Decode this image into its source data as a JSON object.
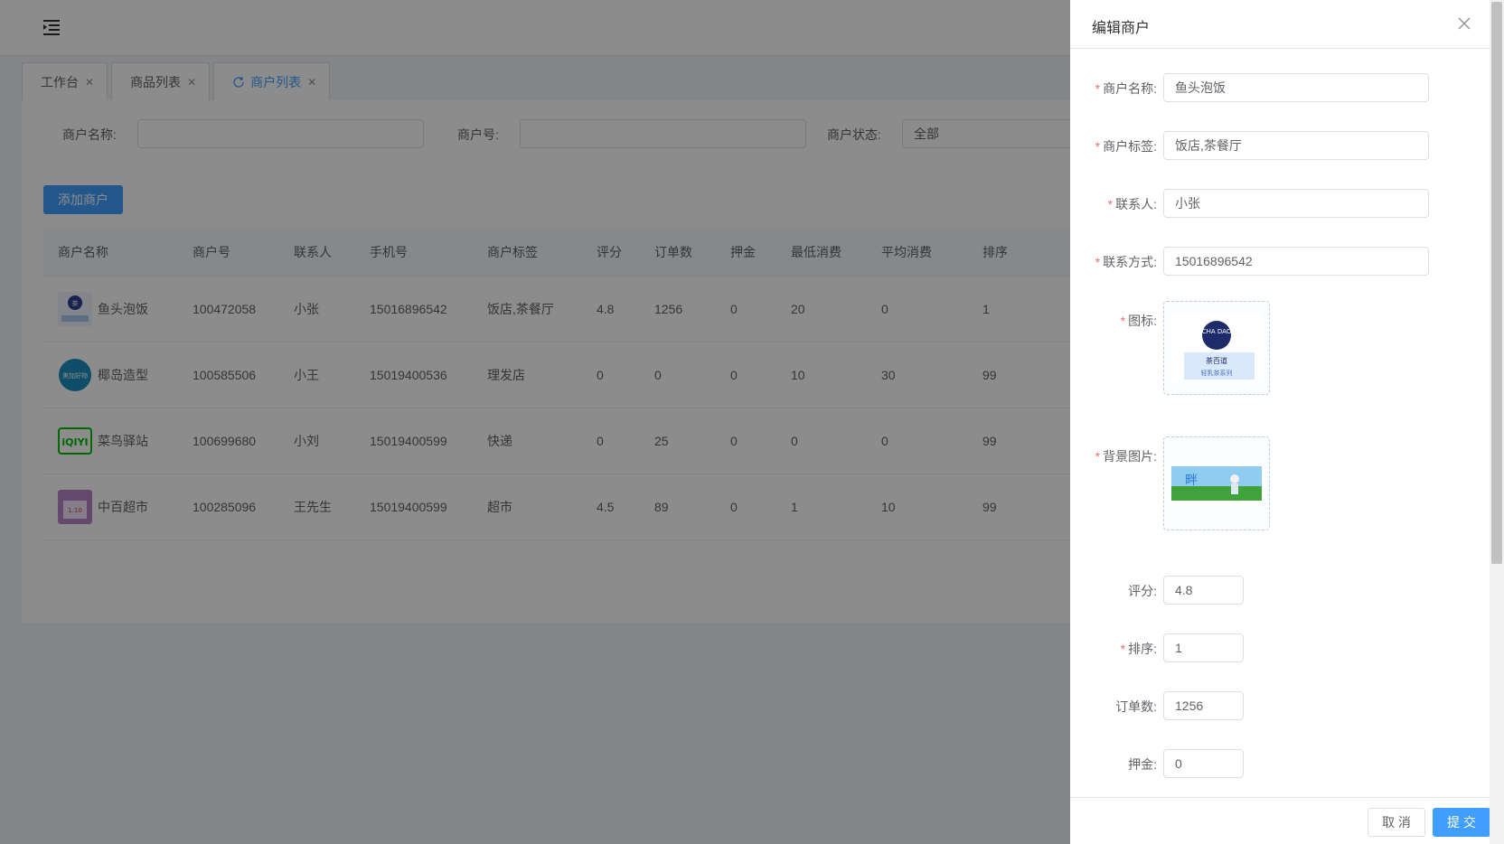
{
  "header": {
    "menu_icon": "indent-menu-icon"
  },
  "tabs": [
    {
      "label": "工作台",
      "active": false
    },
    {
      "label": "商品列表",
      "active": false
    },
    {
      "label": "商户列表",
      "active": true
    }
  ],
  "search": {
    "merchant_name_label": "商户名称:",
    "merchant_name_value": "",
    "merchant_no_label": "商户号:",
    "merchant_no_value": "",
    "status_label": "商户状态:",
    "status_value": "全部"
  },
  "toolbar": {
    "add_label": "添加商户"
  },
  "table": {
    "columns": [
      "商户名称",
      "商户号",
      "联系人",
      "手机号",
      "商户标签",
      "评分",
      "订单数",
      "押金",
      "最低消费",
      "平均消费",
      "排序"
    ],
    "rows": [
      [
        "鱼头泡饭",
        "100472058",
        "小张",
        "15016896542",
        "饭店,茶餐厅",
        "4.8",
        "1256",
        "0",
        "20",
        "0",
        "1"
      ],
      [
        "椰岛造型",
        "100585506",
        "小王",
        "15019400536",
        "理发店",
        "0",
        "0",
        "0",
        "10",
        "30",
        "99"
      ],
      [
        "菜鸟驿站",
        "100699680",
        "小刘",
        "15019400599",
        "快递",
        "0",
        "25",
        "0",
        "0",
        "0",
        "99"
      ],
      [
        "中百超市",
        "100285096",
        "王先生",
        "15019400599",
        "超市",
        "4.5",
        "89",
        "0",
        "1",
        "10",
        "99"
      ]
    ],
    "logos": [
      {
        "text": "茶",
        "color": "#2a3f8f"
      },
      {
        "text": "美加好物",
        "color": "#1a8fbf"
      },
      {
        "text": "iQIYI",
        "color": "#00be06"
      },
      {
        "text": "1.10",
        "color": "#b784c9"
      }
    ]
  },
  "drawer": {
    "title": "编辑商户",
    "fields": {
      "name": {
        "label": "商户名称:",
        "value": "鱼头泡饭",
        "required": true
      },
      "tags": {
        "label": "商户标签:",
        "value": "饭店,茶餐厅",
        "required": true
      },
      "contact": {
        "label": "联系人:",
        "value": "小张",
        "required": true
      },
      "phone": {
        "label": "联系方式:",
        "value": "15016896542",
        "required": true
      },
      "icon": {
        "label": "图标:",
        "required": true,
        "caption_top": "CHA DAO",
        "caption_bottom": "茶百道",
        "caption_sub": "轻乳茶系列"
      },
      "background": {
        "label": "背景图片:",
        "required": true,
        "caption": "畔"
      },
      "rating": {
        "label": "评分:",
        "value": "4.8",
        "required": false
      },
      "sort": {
        "label": "排序:",
        "value": "1",
        "required": true
      },
      "orders": {
        "label": "订单数:",
        "value": "1256",
        "required": false
      },
      "deposit": {
        "label": "押金:",
        "value": "0",
        "required": false
      }
    },
    "cancel_label": "取 消",
    "submit_label": "提 交"
  },
  "colors": {
    "primary": "#409eff",
    "required": "#f56c6c",
    "mask": "rgba(0,0,0,0.45)"
  }
}
